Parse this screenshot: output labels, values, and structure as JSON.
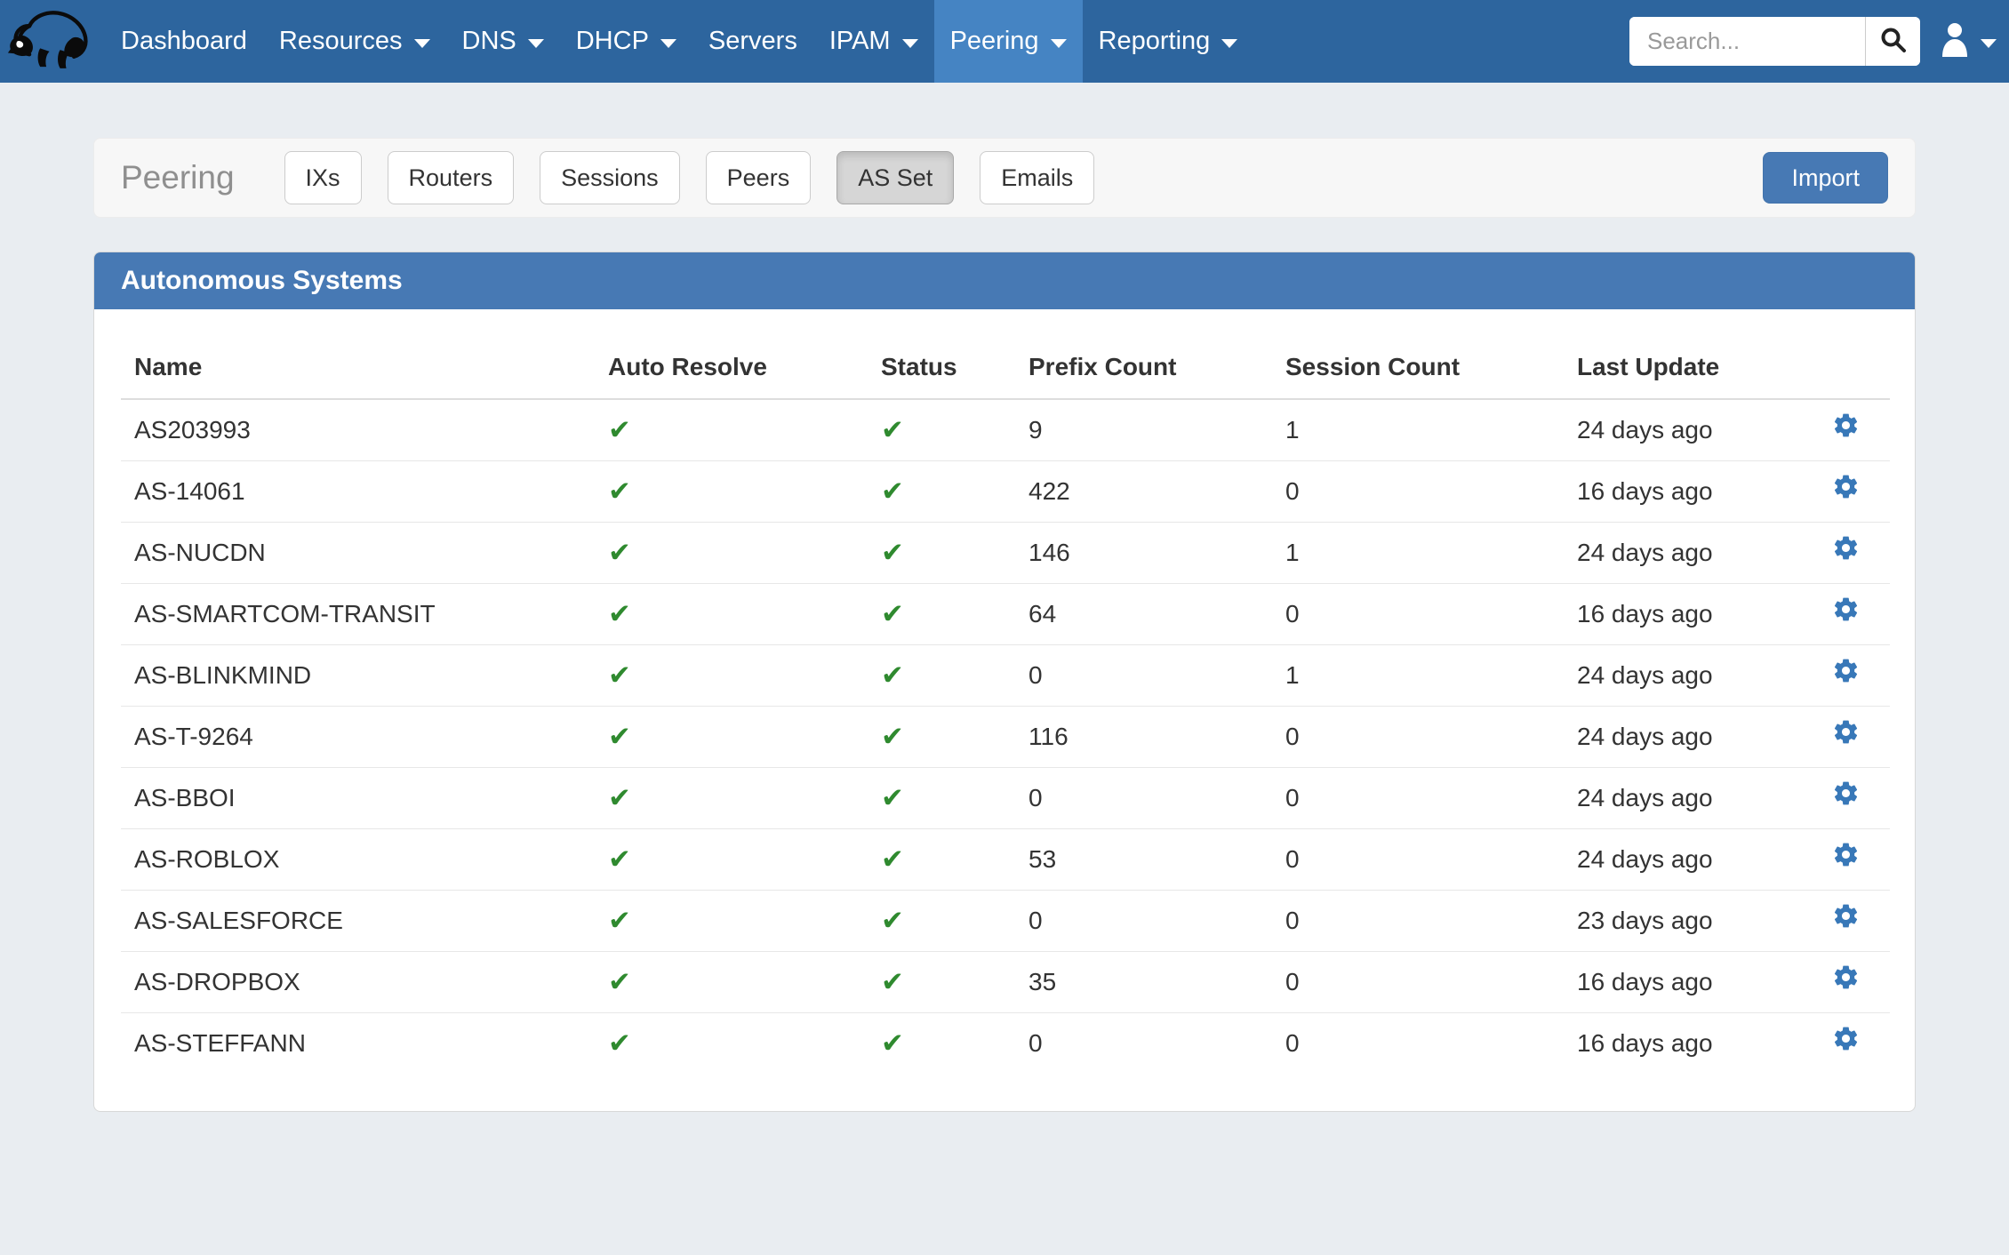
{
  "navbar": {
    "logo_icon": "badger-logo",
    "items": [
      {
        "label": "Dashboard",
        "caret": false,
        "active": false
      },
      {
        "label": "Resources",
        "caret": true,
        "active": false
      },
      {
        "label": "DNS",
        "caret": true,
        "active": false
      },
      {
        "label": "DHCP",
        "caret": true,
        "active": false
      },
      {
        "label": "Servers",
        "caret": false,
        "active": false
      },
      {
        "label": "IPAM",
        "caret": true,
        "active": false
      },
      {
        "label": "Peering",
        "caret": true,
        "active": true
      },
      {
        "label": "Reporting",
        "caret": true,
        "active": false
      }
    ],
    "search": {
      "placeholder": "Search...",
      "button_icon": "search-icon"
    },
    "user_icon": "user-icon"
  },
  "toolbar": {
    "title": "Peering",
    "tabs": [
      {
        "label": "IXs",
        "active": false
      },
      {
        "label": "Routers",
        "active": false
      },
      {
        "label": "Sessions",
        "active": false
      },
      {
        "label": "Peers",
        "active": false
      },
      {
        "label": "AS Set",
        "active": true
      },
      {
        "label": "Emails",
        "active": false
      }
    ],
    "import_label": "Import"
  },
  "panel": {
    "title": "Autonomous Systems",
    "columns": [
      "Name",
      "Auto Resolve",
      "Status",
      "Prefix Count",
      "Session Count",
      "Last Update"
    ],
    "check_glyph": "✔",
    "row_action_icon": "gear-icon",
    "rows": [
      {
        "name": "AS203993",
        "auto_resolve": true,
        "status": true,
        "prefix_count": "9",
        "session_count": "1",
        "last_update": "24 days ago"
      },
      {
        "name": "AS-14061",
        "auto_resolve": true,
        "status": true,
        "prefix_count": "422",
        "session_count": "0",
        "last_update": "16 days ago"
      },
      {
        "name": "AS-NUCDN",
        "auto_resolve": true,
        "status": true,
        "prefix_count": "146",
        "session_count": "1",
        "last_update": "24 days ago"
      },
      {
        "name": "AS-SMARTCOM-TRANSIT",
        "auto_resolve": true,
        "status": true,
        "prefix_count": "64",
        "session_count": "0",
        "last_update": "16 days ago"
      },
      {
        "name": "AS-BLINKMIND",
        "auto_resolve": true,
        "status": true,
        "prefix_count": "0",
        "session_count": "1",
        "last_update": "24 days ago"
      },
      {
        "name": "AS-T-9264",
        "auto_resolve": true,
        "status": true,
        "prefix_count": "116",
        "session_count": "0",
        "last_update": "24 days ago"
      },
      {
        "name": "AS-BBOI",
        "auto_resolve": true,
        "status": true,
        "prefix_count": "0",
        "session_count": "0",
        "last_update": "24 days ago"
      },
      {
        "name": "AS-ROBLOX",
        "auto_resolve": true,
        "status": true,
        "prefix_count": "53",
        "session_count": "0",
        "last_update": "24 days ago"
      },
      {
        "name": "AS-SALESFORCE",
        "auto_resolve": true,
        "status": true,
        "prefix_count": "0",
        "session_count": "0",
        "last_update": "23 days ago"
      },
      {
        "name": "AS-DROPBOX",
        "auto_resolve": true,
        "status": true,
        "prefix_count": "35",
        "session_count": "0",
        "last_update": "16 days ago"
      },
      {
        "name": "AS-STEFFANN",
        "auto_resolve": true,
        "status": true,
        "prefix_count": "0",
        "session_count": "0",
        "last_update": "16 days ago"
      }
    ]
  },
  "colors": {
    "navbar_bg": "#2d659e",
    "navbar_active_bg": "#4584c3",
    "accent_blue": "#4779b4",
    "check_green": "#2f8a2f",
    "gear_blue": "#3878b8",
    "page_bg": "#e9edf1",
    "toolbar_bg": "#f7f7f7"
  }
}
